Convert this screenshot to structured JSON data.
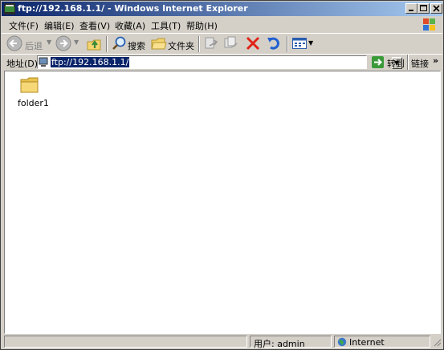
{
  "window": {
    "title": "ftp://192.168.1.1/ - Windows Internet Explorer"
  },
  "menu": [
    "文件(F)",
    "编辑(E)",
    "查看(V)",
    "收藏(A)",
    "工具(T)",
    "帮助(H)"
  ],
  "toolbar": {
    "back_label": "后退",
    "search_label": "搜索",
    "folders_label": "文件夹"
  },
  "address": {
    "label": "地址(D)",
    "url": "ftp://192.168.1.1/",
    "go_label": "转到",
    "links_label": "链接"
  },
  "files": [
    {
      "name": "folder1"
    }
  ],
  "status": {
    "user": "用户: admin",
    "zone": "Internet"
  },
  "colors": {
    "titlebar_start": "#0a246a",
    "titlebar_end": "#a6caf0",
    "chrome": "#d4d0c8",
    "folder": "#f3d46e"
  }
}
